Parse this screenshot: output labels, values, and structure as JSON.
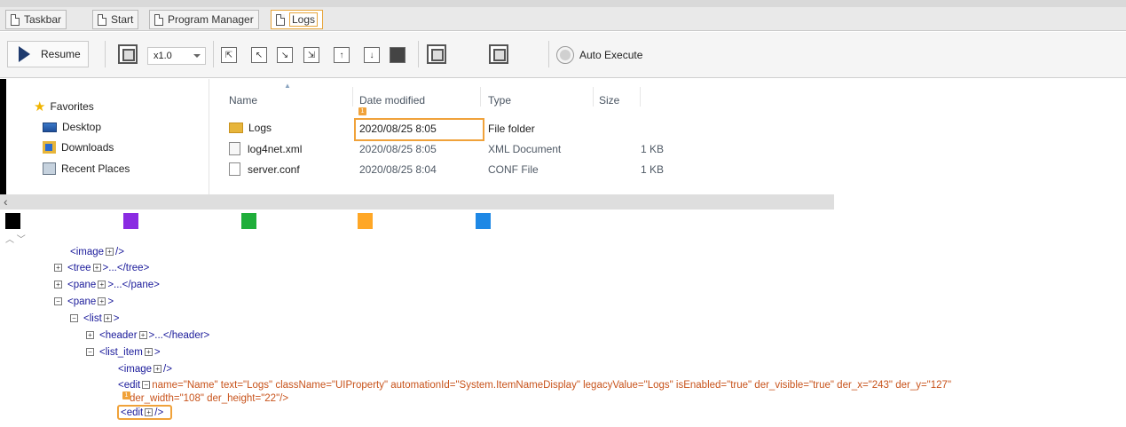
{
  "tabs": [
    {
      "label": "Taskbar",
      "active": false
    },
    {
      "label": "Start",
      "active": false
    },
    {
      "label": "Program Manager",
      "active": false
    },
    {
      "label": "Logs",
      "active": true
    }
  ],
  "toolbar": {
    "resume_label": "Resume",
    "speed_value": "x1.0",
    "auto_execute_label": "Auto Execute"
  },
  "navigation": {
    "favorites_label": "Favorites",
    "items": [
      "Desktop",
      "Downloads",
      "Recent Places"
    ]
  },
  "file_list": {
    "columns": [
      "Name",
      "Date modified",
      "Type",
      "Size"
    ],
    "rows": [
      {
        "name": "Logs",
        "date": "2020/08/25 8:05",
        "type": "File folder",
        "size": ""
      },
      {
        "name": "log4net.xml",
        "date": "2020/08/25 8:05",
        "type": "XML Document",
        "size": "1 KB"
      },
      {
        "name": "server.conf",
        "date": "2020/08/25 8:04",
        "type": "CONF File",
        "size": "1 KB"
      }
    ],
    "highlight_badge": "1"
  },
  "swatch_colors": [
    "#000000",
    "#8a2be2",
    "#1fae3a",
    "#ffa726",
    "#1e88e5"
  ],
  "xml_tree": {
    "lines": {
      "l0": "<image",
      "l0b": "/>",
      "l1": "<tree",
      "l1b": ">...</tree>",
      "l2": "<pane",
      "l2b": ">...</pane>",
      "l3": "<pane",
      "l3b": ">",
      "l4": "<list",
      "l4b": ">",
      "l5": "<header",
      "l5b": ">...</header>",
      "l6": "<list_item",
      "l6b": ">",
      "l7": "<image",
      "l7b": "/>",
      "l8_tag": "<edit",
      "l8_rest": "name=\"Name\" text=\"Logs\" className=\"UIProperty\" automationId=\"System.ItemNameDisplay\" legacyValue=\"Logs\" isEnabled=\"true\" der_visible=\"true\" der_x=\"243\" der_y=\"127\"",
      "l9": "der_width=\"108\" der_height=\"22\"/>",
      "l10": "<edit",
      "l10b": "/>"
    },
    "highlight_badge": "1"
  }
}
